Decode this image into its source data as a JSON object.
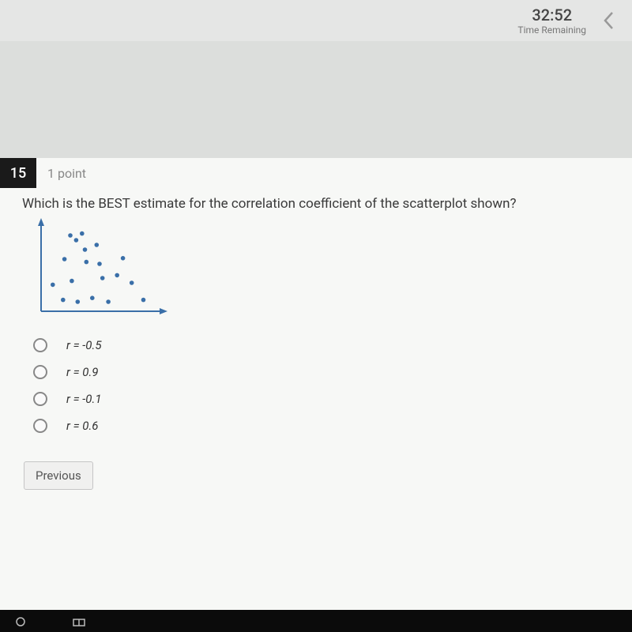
{
  "header": {
    "time": "32:52",
    "time_label": "Time Remaining"
  },
  "question": {
    "number": "15",
    "points": "1 point",
    "text": "Which is the BEST estimate for the correlation coefficient of the scatterplot shown?"
  },
  "options": [
    {
      "label": "r = -0.5"
    },
    {
      "label": "r = 0.9"
    },
    {
      "label": "r = -0.1"
    },
    {
      "label": "r = 0.6"
    }
  ],
  "buttons": {
    "previous": "Previous"
  },
  "chart_data": {
    "type": "scatter",
    "points": [
      {
        "x": 0.8,
        "y": 2.8
      },
      {
        "x": 1.5,
        "y": 1.2
      },
      {
        "x": 1.6,
        "y": 5.5
      },
      {
        "x": 2.0,
        "y": 8.0
      },
      {
        "x": 2.1,
        "y": 3.2
      },
      {
        "x": 2.4,
        "y": 7.5
      },
      {
        "x": 2.5,
        "y": 1.0
      },
      {
        "x": 2.8,
        "y": 8.2
      },
      {
        "x": 3.0,
        "y": 6.5
      },
      {
        "x": 3.1,
        "y": 5.2
      },
      {
        "x": 3.5,
        "y": 1.4
      },
      {
        "x": 3.8,
        "y": 7.0
      },
      {
        "x": 4.0,
        "y": 5.0
      },
      {
        "x": 4.2,
        "y": 3.5
      },
      {
        "x": 4.6,
        "y": 1.0
      },
      {
        "x": 5.2,
        "y": 3.8
      },
      {
        "x": 5.6,
        "y": 5.6
      },
      {
        "x": 6.2,
        "y": 3.0
      },
      {
        "x": 7.0,
        "y": 1.2
      }
    ],
    "xlim": [
      0,
      8
    ],
    "ylim": [
      0,
      9
    ]
  }
}
